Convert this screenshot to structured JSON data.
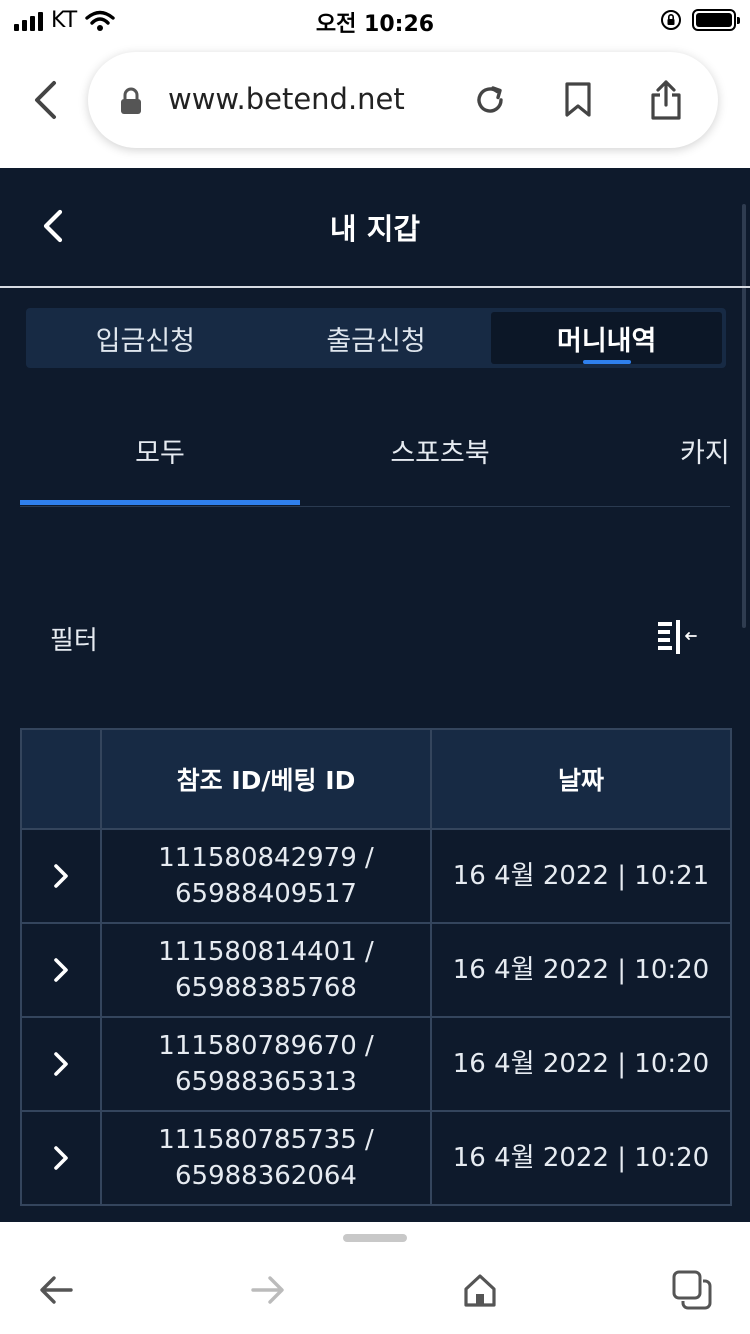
{
  "status_bar": {
    "carrier": "KT",
    "time": "오전 10:26"
  },
  "browser": {
    "url": "www.betend.net"
  },
  "app": {
    "title": "내 지갑",
    "segments": [
      {
        "label": "입금신청",
        "active": false
      },
      {
        "label": "출금신청",
        "active": false
      },
      {
        "label": "머니내역",
        "active": true
      }
    ],
    "subtabs": [
      {
        "label": "모두",
        "active": true
      },
      {
        "label": "스포츠북",
        "active": false
      },
      {
        "label": "카지",
        "active": false
      }
    ],
    "filter_label": "필터",
    "table": {
      "headers": [
        "",
        "참조 ID/베팅 ID",
        "날짜"
      ],
      "rows": [
        {
          "ref_id": "111580842979 /",
          "bet_id": "65988409517",
          "date": "16 4월 2022 | 10:21"
        },
        {
          "ref_id": "111580814401 /",
          "bet_id": "65988385768",
          "date": "16 4월 2022 | 10:20"
        },
        {
          "ref_id": "111580789670 /",
          "bet_id": "65988365313",
          "date": "16 4월 2022 | 10:20"
        },
        {
          "ref_id": "111580785735 /",
          "bet_id": "65988362064",
          "date": "16 4월 2022 | 10:20"
        }
      ]
    }
  },
  "colors": {
    "app_background": "#0e1a2c",
    "header_cell": "#172a44",
    "accent": "#2f80ed"
  }
}
